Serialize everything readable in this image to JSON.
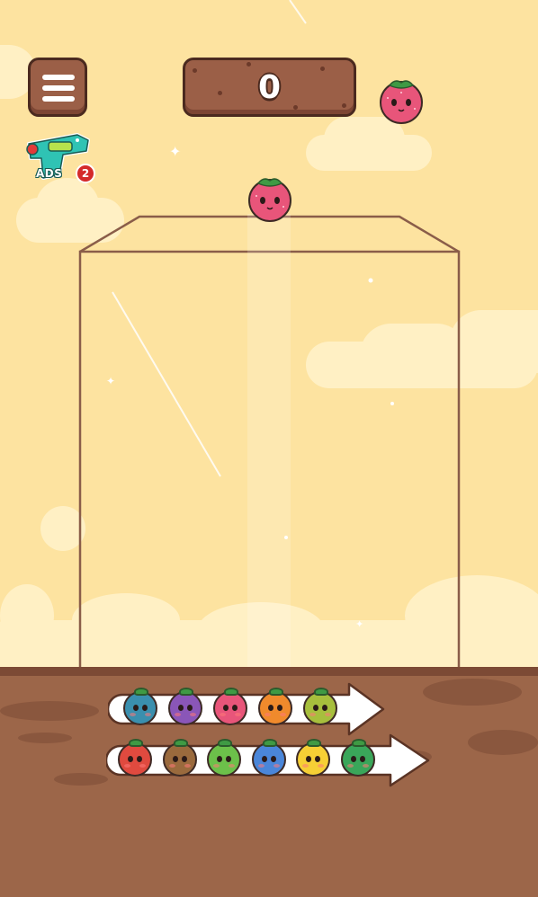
{
  "hud": {
    "score": "0",
    "menu_icon": "hamburger-menu-icon"
  },
  "next_fruit": {
    "name": "strawberry",
    "color": "#e8557a"
  },
  "current_fruit": {
    "name": "strawberry",
    "color": "#e8557a"
  },
  "powerup": {
    "icon": "blaster-gun-icon",
    "label": "ADS",
    "count": "2"
  },
  "colors": {
    "sky": "#fde3a0",
    "cloud": "#fff0c4",
    "ground": "#9c6649",
    "wood": "#9b5f47",
    "outline": "#4b2a1f"
  },
  "evolution": {
    "row1": [
      {
        "name": "blueberry-eye",
        "color": "#3a8fae"
      },
      {
        "name": "grape",
        "color": "#8a56b8"
      },
      {
        "name": "strawberry",
        "color": "#e8557a"
      },
      {
        "name": "orange",
        "color": "#f08a2c"
      },
      {
        "name": "lime",
        "color": "#a7bf3d"
      }
    ],
    "row2": [
      {
        "name": "tomato",
        "color": "#e04a3f"
      },
      {
        "name": "kiwi",
        "color": "#9a6a3d"
      },
      {
        "name": "green-apple",
        "color": "#6cc04a"
      },
      {
        "name": "blue-fruit",
        "color": "#4a86d9"
      },
      {
        "name": "lemon",
        "color": "#f6cf35"
      },
      {
        "name": "watermelon",
        "color": "#3aa65a"
      }
    ]
  }
}
